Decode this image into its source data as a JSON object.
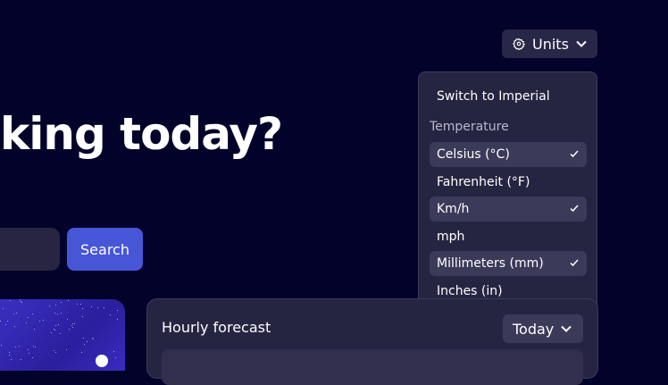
{
  "hero": {
    "heading": "king today?"
  },
  "search": {
    "button_label": "Search"
  },
  "units_menu": {
    "button_label": "Units",
    "switch_label": "Switch to Imperial",
    "section_label": "Temperature",
    "items": [
      {
        "label": "Celsius (°C)",
        "selected": true
      },
      {
        "label": "Fahrenheit (°F)",
        "selected": false
      },
      {
        "label": "Km/h",
        "selected": true
      },
      {
        "label": "mph",
        "selected": false
      },
      {
        "label": "Millimeters (mm)",
        "selected": true
      },
      {
        "label": "Inches (in)",
        "selected": false
      }
    ]
  },
  "forecast": {
    "title": "Hourly forecast",
    "day": "Today"
  },
  "colors": {
    "background": "#03022a",
    "accent": "#4656d7",
    "panel": "#262541",
    "selected": "#3c3a59"
  }
}
